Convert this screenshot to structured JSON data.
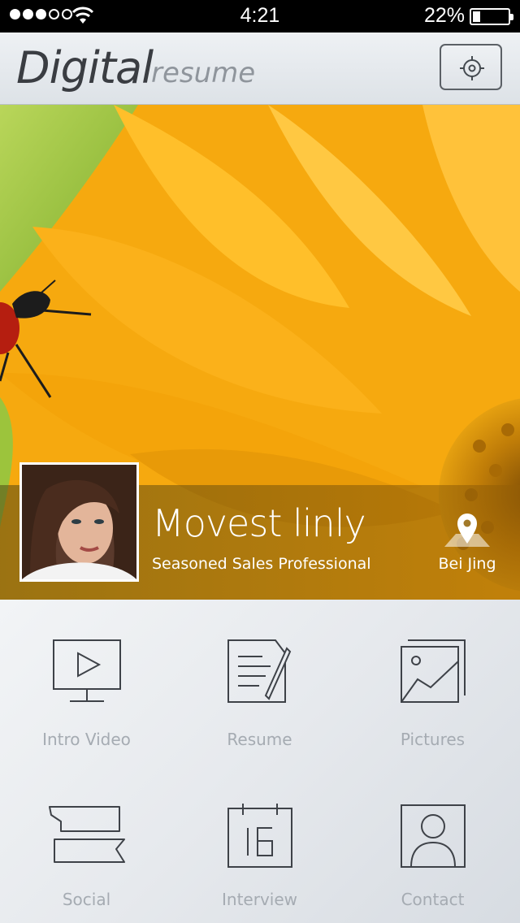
{
  "status_bar": {
    "signal_dots_filled": 3,
    "signal_dots_total": 5,
    "time": "4:21",
    "battery_percent": "22%",
    "battery_level": 0.22
  },
  "header": {
    "title_main": "Digital",
    "title_sub": "resume",
    "settings_icon": "gear-icon"
  },
  "profile": {
    "name": "Movest linly",
    "tagline": "Seasoned Sales Professional",
    "location": "Bei Jing",
    "location_icon": "map-pin-icon"
  },
  "menu": [
    {
      "label": "Intro Video",
      "icon": "video-play-icon"
    },
    {
      "label": "Resume",
      "icon": "document-edit-icon"
    },
    {
      "label": "Pictures",
      "icon": "pictures-icon"
    },
    {
      "label": "Social",
      "icon": "social-chat-icon"
    },
    {
      "label": "Interview",
      "icon": "calendar-icon"
    },
    {
      "label": "Contact",
      "icon": "contact-person-icon"
    }
  ],
  "colors": {
    "header_bg": "#e6e9ed",
    "title_color": "#3a3d42",
    "icon_stroke": "#3e4248",
    "label_color": "#a5abb2"
  }
}
